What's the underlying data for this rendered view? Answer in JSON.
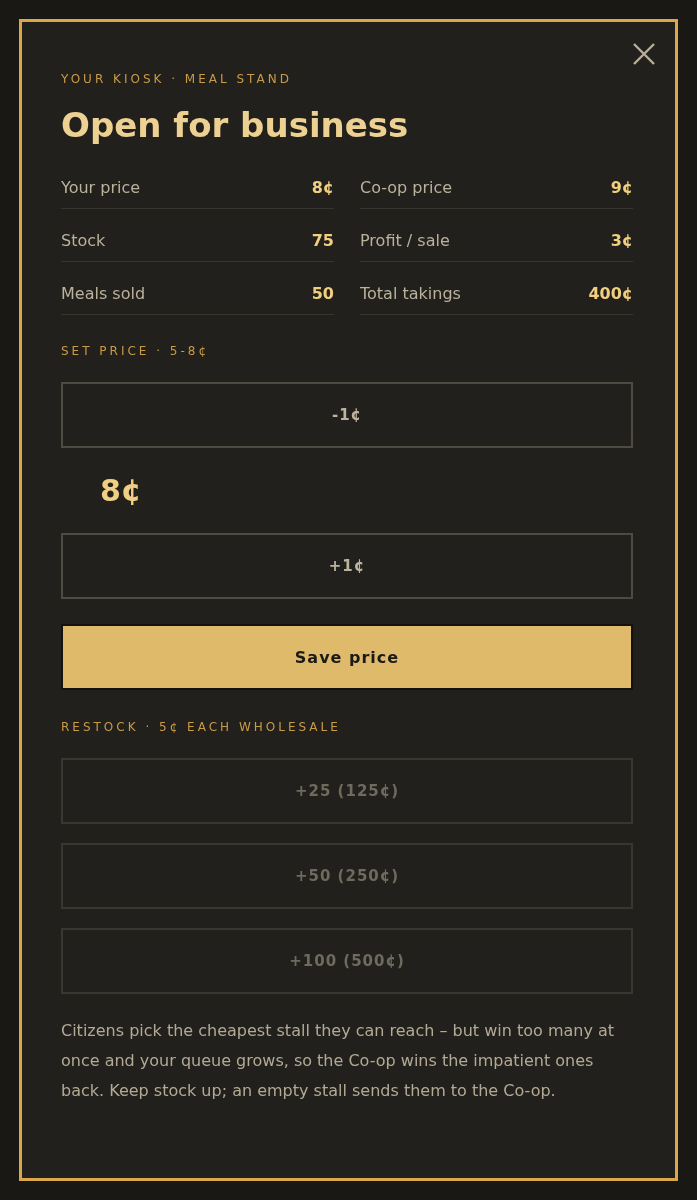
{
  "dialog": {
    "eyebrow": "YOUR KIOSK · MEAL STAND",
    "title": "Open for business"
  },
  "stats": [
    {
      "label": "Your price",
      "value": "8¢"
    },
    {
      "label": "Co-op price",
      "value": "9¢"
    },
    {
      "label": "Stock",
      "value": "75"
    },
    {
      "label": "Profit / sale",
      "value": "3¢"
    },
    {
      "label": "Meals sold",
      "value": "50"
    },
    {
      "label": "Total takings",
      "value": "400¢"
    }
  ],
  "price_section": {
    "heading": "SET PRICE · 5-8¢",
    "decrease_button": {
      "label": "-1¢",
      "disabled": false
    },
    "current_price": "8¢",
    "increase_button": {
      "label": "+1¢",
      "disabled": false
    },
    "save_button": {
      "label": "Save price"
    }
  },
  "restock_section": {
    "heading": "RESTOCK · 5¢ EACH WHOLESALE",
    "options": [
      {
        "label": "+25 (125¢)",
        "disabled": true
      },
      {
        "label": "+50 (250¢)",
        "disabled": true
      },
      {
        "label": "+100 (500¢)",
        "disabled": true
      }
    ]
  },
  "note": "Citizens pick the cheapest stall they can reach – but win too many at once and your queue grows, so the Co-op wins the impatient ones back. Keep stock up; an empty stall sends them to the Co-op."
}
